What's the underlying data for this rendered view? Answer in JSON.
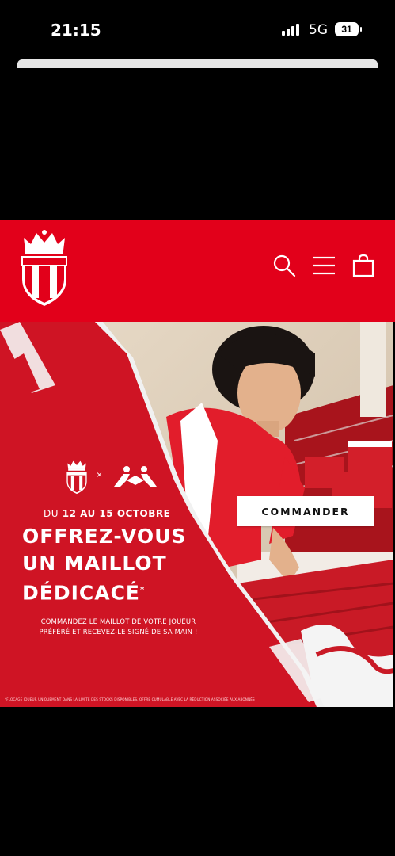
{
  "status_bar": {
    "time": "21:15",
    "network": "5G",
    "battery": "31"
  },
  "header": {
    "logo_text": "ASMONACOFC",
    "icons": [
      "search-icon",
      "menu-icon",
      "cart-icon"
    ],
    "background": "#e2001a"
  },
  "banner": {
    "dates_prefix": "DU",
    "dates_main": "12 AU 15 OCTOBRE",
    "headline_line1": "OFFREZ-VOUS",
    "headline_line2": "UN MAILLOT",
    "headline_line3": "DÉDICACÉ",
    "headline_mark": "*",
    "subtext_line1": "COMMANDEZ LE MAILLOT DE VOTRE JOUEUR",
    "subtext_line2": "PRÉFÉRÉ ET RECEVEZ-LE SIGNÉ DE SA MAIN !",
    "footnote": "*FLOCAGE JOUEUR UNIQUEMENT DANS LA LIMITE DES STOCKS DISPONIBLES. OFFRE CUMULABLE AVEC LA RÉDUCTION ASSOCIÉE AUX ABONNÉS",
    "times_sign": "×",
    "cta_label": "COMMANDER",
    "primary_color": "#cf1424"
  }
}
